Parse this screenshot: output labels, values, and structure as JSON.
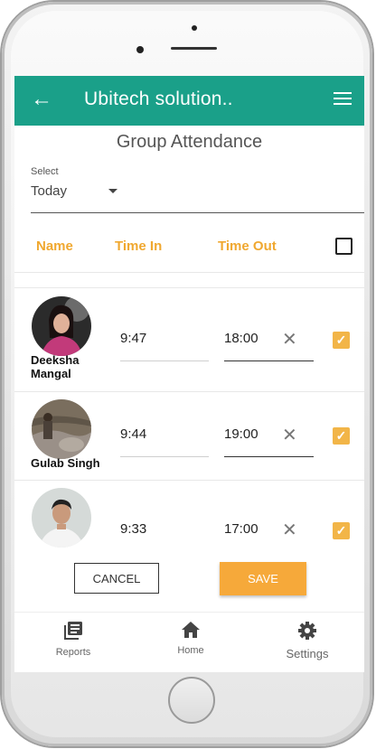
{
  "appbar": {
    "back_icon": "arrow-left-icon",
    "title": "Ubitech solution..",
    "menu_icon": "hamburger-menu-icon",
    "color": "#1aa089"
  },
  "page": {
    "title": "Group Attendance"
  },
  "select": {
    "label": "Select",
    "value": "Today"
  },
  "table": {
    "headers": {
      "name": "Name",
      "time_in": "Time In",
      "time_out": "Time Out"
    },
    "header_color": "#f0a830",
    "select_all_checked": false,
    "rows": [
      {
        "name": "Deeksha Mangal",
        "time_in": "9:47",
        "time_out": "18:00",
        "checked": true
      },
      {
        "name": "Gulab Singh",
        "time_in": "9:44",
        "time_out": "19:00",
        "checked": true
      },
      {
        "name": "",
        "time_in": "9:33",
        "time_out": "17:00",
        "checked": true
      }
    ]
  },
  "actions": {
    "cancel_label": "CANCEL",
    "save_label": "SAVE",
    "save_color": "#f6a93a"
  },
  "bottom_nav": {
    "items": [
      {
        "label": "Reports",
        "icon": "reports-icon"
      },
      {
        "label": "Home",
        "icon": "home-icon"
      },
      {
        "label": "Settings",
        "icon": "gear-icon"
      }
    ]
  }
}
